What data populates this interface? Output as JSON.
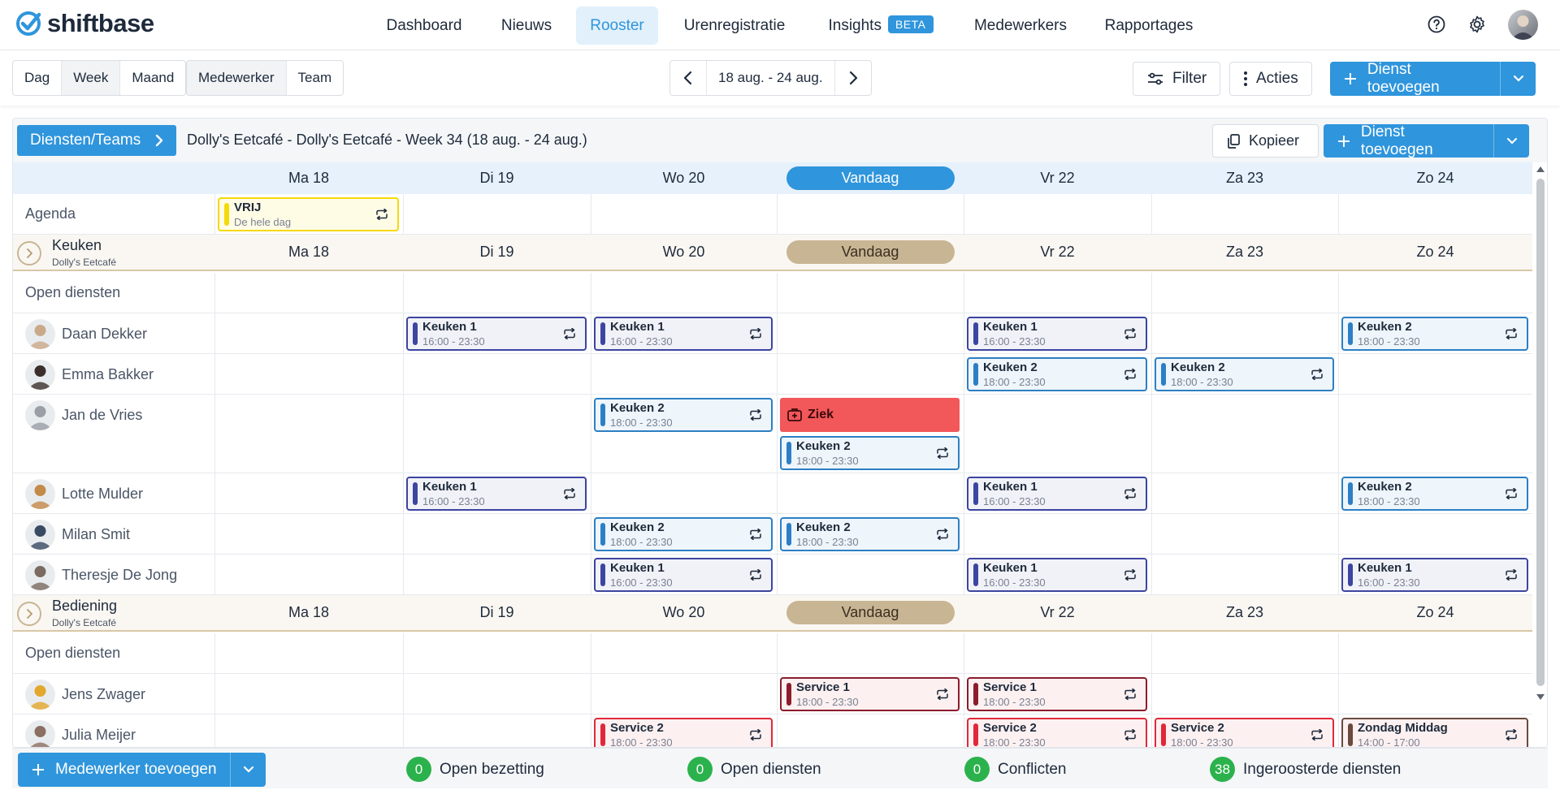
{
  "brand": {
    "name": "shiftbase",
    "color": "#2f95dc"
  },
  "nav": {
    "items": [
      {
        "label": "Dashboard"
      },
      {
        "label": "Nieuws"
      },
      {
        "label": "Rooster",
        "active": true
      },
      {
        "label": "Urenregistratie"
      },
      {
        "label": "Insights",
        "badge": "BETA"
      },
      {
        "label": "Medewerkers"
      },
      {
        "label": "Rapportages"
      }
    ],
    "icons": [
      "help-icon",
      "gear-icon",
      "user-avatar"
    ]
  },
  "toolbar": {
    "period_tabs": [
      {
        "label": "Dag"
      },
      {
        "label": "Week",
        "active": true
      },
      {
        "label": "Maand"
      }
    ],
    "view_tabs": [
      {
        "label": "Medewerker"
      },
      {
        "label": "Team"
      }
    ],
    "date_range": "18 aug. - 24 aug.",
    "filter_label": "Filter",
    "actions_label": "Acties",
    "add_shift_label": "Dienst toevoegen"
  },
  "schedule": {
    "diensten_label": "Diensten/Teams",
    "title": "Dolly's Eetcafé - Dolly's Eetcafé - Week 34 (18 aug. - 24 aug.)",
    "copy_label": "Kopieer",
    "add_shift_label": "Dienst toevoegen",
    "days": [
      "Ma 18",
      "Di 19",
      "Wo 20",
      "Vandaag",
      "Vr 22",
      "Za 23",
      "Zo 24"
    ],
    "today_index": 3,
    "agenda": {
      "label": "Agenda",
      "events": [
        {
          "day": 0,
          "title": "VRIJ",
          "subtitle": "De hele dag"
        }
      ]
    },
    "groups": [
      {
        "name": "Keuken",
        "location": "Dolly's Eetcafé",
        "open_label": "Open diensten",
        "employees": [
          {
            "name": "Daan Dekker",
            "shifts": [
              {
                "day": 1,
                "title": "Keuken 1",
                "time": "16:00 - 23:30"
              },
              {
                "day": 2,
                "title": "Keuken 1",
                "time": "16:00 - 23:30"
              },
              {
                "day": 4,
                "title": "Keuken 1",
                "time": "16:00 - 23:30"
              },
              {
                "day": 6,
                "title": "Keuken 2",
                "time": "18:00 - 23:30"
              }
            ]
          },
          {
            "name": "Emma Bakker",
            "shifts": [
              {
                "day": 4,
                "title": "Keuken 2",
                "time": "18:00 - 23:30"
              },
              {
                "day": 5,
                "title": "Keuken 2",
                "time": "18:00 - 23:30"
              }
            ]
          },
          {
            "name": "Jan de Vries",
            "absence": {
              "day": 3,
              "label": "Ziek"
            },
            "shifts": [
              {
                "day": 2,
                "title": "Keuken 2",
                "time": "18:00 - 23:30"
              },
              {
                "day": 3,
                "title": "Keuken 2",
                "time": "18:00 - 23:30",
                "stacked": true
              }
            ]
          },
          {
            "name": "Lotte Mulder",
            "shifts": [
              {
                "day": 1,
                "title": "Keuken 1",
                "time": "16:00 - 23:30"
              },
              {
                "day": 4,
                "title": "Keuken 1",
                "time": "16:00 - 23:30"
              },
              {
                "day": 6,
                "title": "Keuken 2",
                "time": "18:00 - 23:30"
              }
            ]
          },
          {
            "name": "Milan Smit",
            "shifts": [
              {
                "day": 2,
                "title": "Keuken 2",
                "time": "18:00 - 23:30"
              },
              {
                "day": 3,
                "title": "Keuken 2",
                "time": "18:00 - 23:30"
              }
            ]
          },
          {
            "name": "Theresje De Jong",
            "shifts": [
              {
                "day": 2,
                "title": "Keuken 1",
                "time": "16:00 - 23:30"
              },
              {
                "day": 4,
                "title": "Keuken 1",
                "time": "16:00 - 23:30"
              },
              {
                "day": 6,
                "title": "Keuken 1",
                "time": "16:00 - 23:30"
              }
            ]
          }
        ]
      },
      {
        "name": "Bediening",
        "location": "Dolly's Eetcafé",
        "open_label": "Open diensten",
        "employees": [
          {
            "name": "Jens Zwager",
            "shifts": [
              {
                "day": 3,
                "title": "Service 1",
                "time": "18:00 - 23:30"
              },
              {
                "day": 4,
                "title": "Service 1",
                "time": "18:00 - 23:30"
              }
            ]
          },
          {
            "name": "Julia Meijer",
            "shifts": [
              {
                "day": 2,
                "title": "Service 2",
                "time": "18:00 - 23:30"
              },
              {
                "day": 4,
                "title": "Service 2",
                "time": "18:00 - 23:30"
              },
              {
                "day": 5,
                "title": "Service 2",
                "time": "18:00 - 23:30"
              },
              {
                "day": 6,
                "title": "Zondag Middag",
                "time": "14:00 - 17:00"
              }
            ]
          }
        ]
      }
    ]
  },
  "colors": {
    "keuken1": "#3c45a0",
    "keuken2": "#2c7fc4",
    "service1": "#8c1c2b",
    "service2": "#e0283a",
    "zondag": "#6a4a3c",
    "vrij": "#f5d90a",
    "ziek": "#f2575a",
    "badge": "#2bb24c"
  },
  "footer": {
    "add_employee_label": "Medewerker toevoegen",
    "stats": [
      {
        "count": "0",
        "label": "Open bezetting"
      },
      {
        "count": "0",
        "label": "Open diensten"
      },
      {
        "count": "0",
        "label": "Conflicten"
      },
      {
        "count": "38",
        "label": "Ingeroosterde diensten"
      }
    ]
  }
}
